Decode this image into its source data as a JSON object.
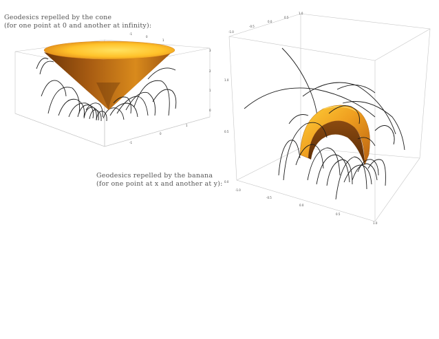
{
  "captions": {
    "cone_line1": "Geodesics repelled by the cone",
    "cone_line2": "(for one point at 0 and another at infinity):",
    "banana_line1": "Geodesics repelled by the banana",
    "banana_line2": "(for one point at x and another at y):"
  },
  "colors": {
    "surface_light": "#ffd23a",
    "surface_mid": "#f0a020",
    "surface_dark": "#7a3f0a",
    "geodesic": "#1a1a1a",
    "box": "#c4c4c4"
  },
  "cone_plot": {
    "ticks_top": [
      "-1",
      "0",
      "1"
    ],
    "ticks_right": [
      "3",
      "2",
      "1",
      "0"
    ],
    "ticks_bottom": [
      "-1",
      "0",
      "1"
    ]
  },
  "banana_plot": {
    "ticks_top": [
      "-1.0",
      "-0.5",
      "0.0",
      "0.5",
      "1.0"
    ],
    "ticks_left": [
      "1.0",
      "0.5",
      "0.0"
    ],
    "ticks_bottom": [
      "-1.0",
      "-0.5",
      "0.0",
      "0.5",
      "1.0"
    ]
  }
}
